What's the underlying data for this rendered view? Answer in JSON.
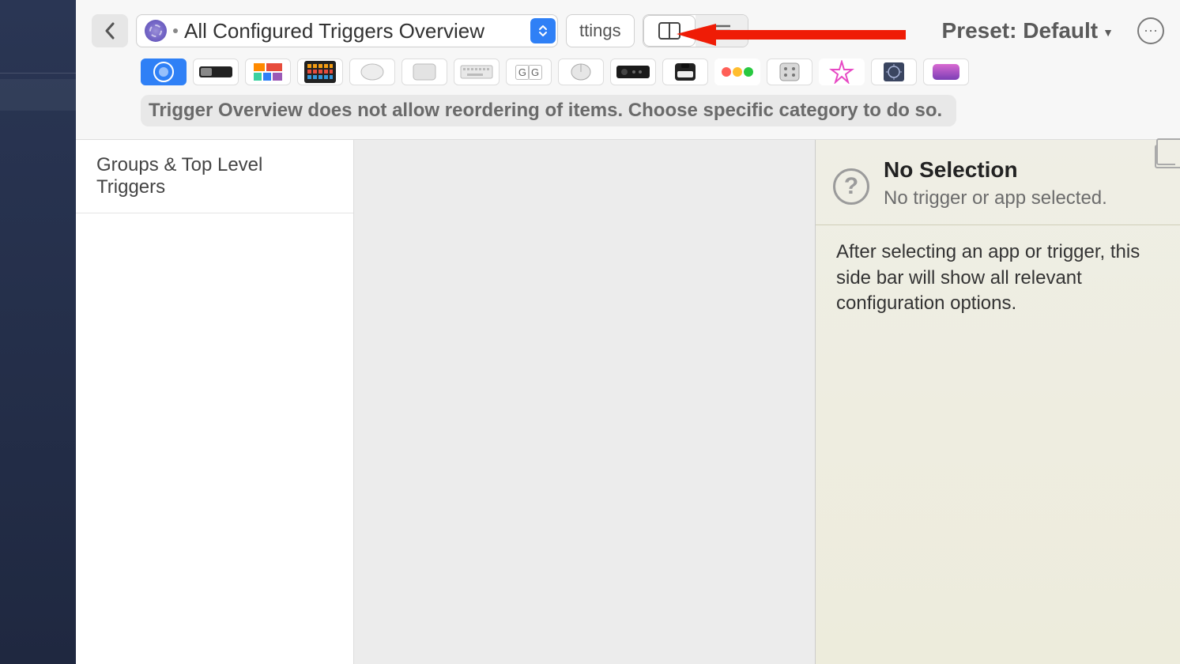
{
  "toolbar": {
    "dropdown_title": "All Configured Triggers Overview",
    "settings_partial": "ttings",
    "preset_label": "Preset: Default"
  },
  "icon_row_items": [
    {
      "name": "all-triggers-icon",
      "selected": true
    },
    {
      "name": "touchbar-icon"
    },
    {
      "name": "floating-menu-icon"
    },
    {
      "name": "stream-deck-icon"
    },
    {
      "name": "magic-mouse-icon"
    },
    {
      "name": "trackpad-icon"
    },
    {
      "name": "keyboard-icon"
    },
    {
      "name": "key-sequence-icon"
    },
    {
      "name": "normal-mouse-icon"
    },
    {
      "name": "remote-icon"
    },
    {
      "name": "notch-bar-icon"
    },
    {
      "name": "window-buttons-icon"
    },
    {
      "name": "siri-remote-icon"
    },
    {
      "name": "drawing-gesture-icon"
    },
    {
      "name": "other-triggers-icon"
    },
    {
      "name": "btt-remote-icon"
    }
  ],
  "info_message": "Trigger Overview does not allow reordering of items. Choose specific category to do so.",
  "groups_header": "Groups & Top Level Triggers",
  "right_panel": {
    "title": "No Selection",
    "subtitle": "No trigger or app selected.",
    "body": "After selecting an app or trigger, this side bar will show all relevant configuration options."
  }
}
